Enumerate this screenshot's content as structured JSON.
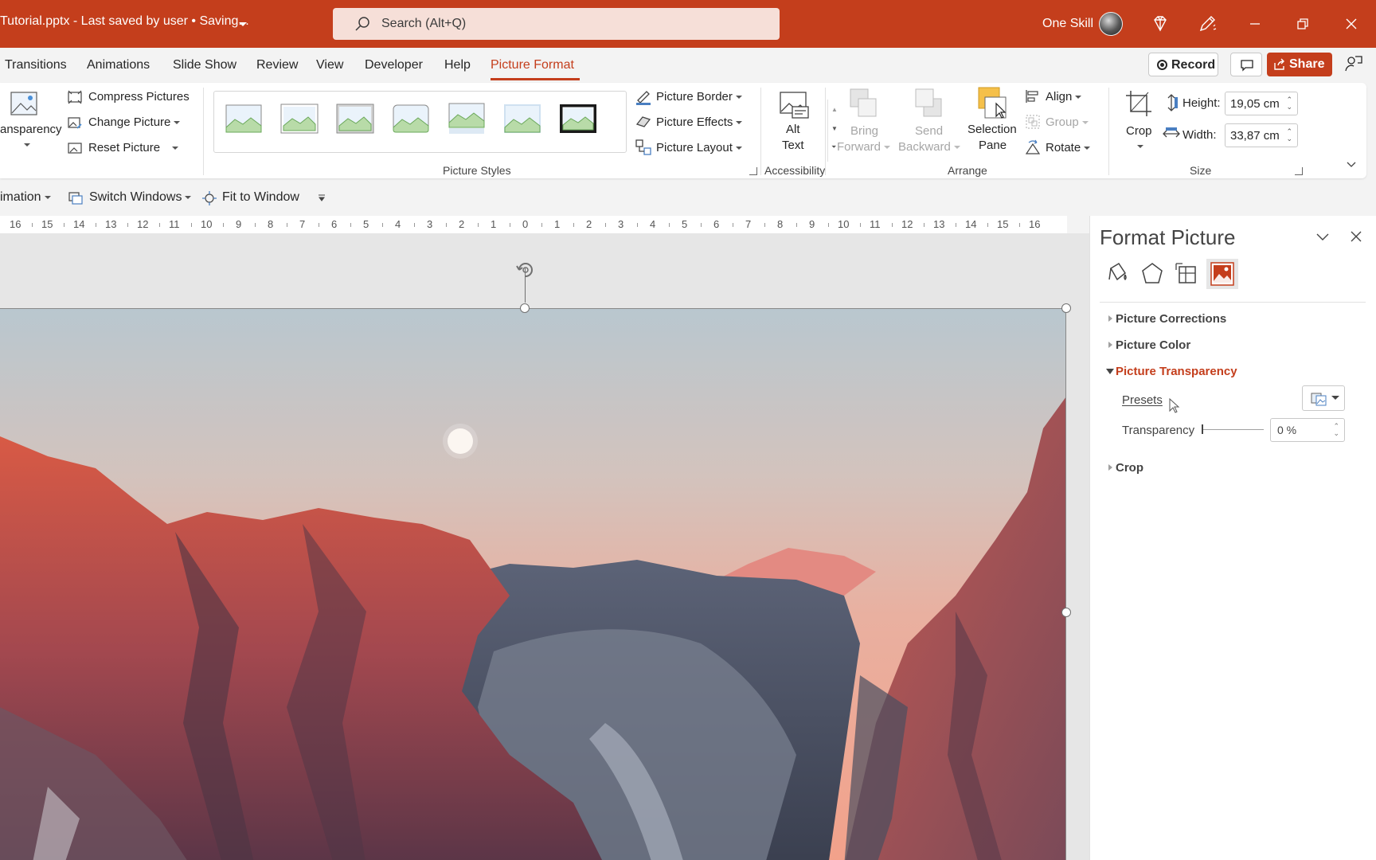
{
  "window": {
    "title": "Tutorial.pptx  -  Last saved by user • Saving...",
    "search_placeholder": "Search (Alt+Q)",
    "user_name": "One Skill",
    "accent_color": "#c43e1c"
  },
  "tabs": [
    "Transitions",
    "Animations",
    "Slide Show",
    "Review",
    "View",
    "Developer",
    "Help",
    "Picture Format"
  ],
  "active_tab": "Picture Format",
  "actions": {
    "record": "Record",
    "share": "Share"
  },
  "ribbon": {
    "adjust": {
      "transparency": "ansparency",
      "compress": "Compress Pictures",
      "change": "Change Picture",
      "reset": "Reset Picture"
    },
    "picture_styles": {
      "label": "Picture Styles",
      "border": "Picture Border",
      "effects": "Picture Effects",
      "layout": "Picture Layout"
    },
    "accessibility": {
      "label": "Accessibility",
      "alt_text_line1": "Alt",
      "alt_text_line2": "Text"
    },
    "arrange": {
      "label": "Arrange",
      "bring_forward_1": "Bring",
      "bring_forward_2": "Forward",
      "send_backward_1": "Send",
      "send_backward_2": "Backward",
      "selection_pane_1": "Selection",
      "selection_pane_2": "Pane",
      "align": "Align",
      "group": "Group",
      "rotate": "Rotate"
    },
    "size": {
      "label": "Size",
      "crop": "Crop",
      "height_label": "Height:",
      "height_value": "19,05 cm",
      "width_label": "Width:",
      "width_value": "33,87 cm"
    }
  },
  "qat": {
    "animation": "imation",
    "switch_windows": "Switch Windows",
    "fit_to_window": "Fit to Window"
  },
  "ruler": [
    "16",
    "15",
    "14",
    "13",
    "12",
    "11",
    "10",
    "9",
    "8",
    "7",
    "6",
    "5",
    "4",
    "3",
    "2",
    "1",
    "0",
    "1",
    "2",
    "3",
    "4",
    "5",
    "6",
    "7",
    "8",
    "9",
    "10",
    "11",
    "12",
    "13",
    "14",
    "15",
    "16"
  ],
  "format_pane": {
    "title": "Format Picture",
    "icons": [
      "fill-line-icon",
      "effects-icon",
      "size-properties-icon",
      "picture-icon"
    ],
    "sections": {
      "corrections": "Picture Corrections",
      "color": "Picture Color",
      "transparency": "Picture Transparency",
      "crop": "Crop"
    },
    "presets_label": "Presets",
    "transparency_label": "Transparency",
    "transparency_value": "0 %"
  }
}
